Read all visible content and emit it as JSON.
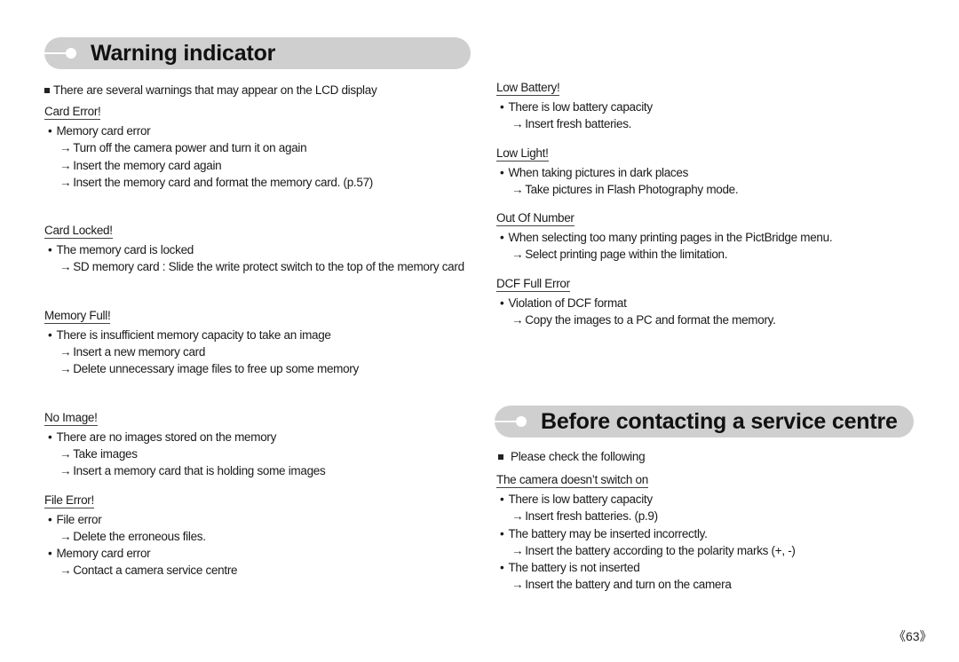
{
  "warning": {
    "title": "Warning indicator",
    "intro": "There are several warnings that may appear on the LCD display",
    "sections_left": [
      {
        "heading": "Card Error!",
        "lines": [
          {
            "type": "bullet",
            "text": "Memory card error"
          },
          {
            "type": "arrow",
            "text": "Turn off the camera power and turn it on again"
          },
          {
            "type": "arrow",
            "text": "Insert the memory card again"
          },
          {
            "type": "arrow",
            "text": "Insert the memory card and format the memory card. (p.57)"
          }
        ]
      },
      {
        "heading": "Card Locked!",
        "lines": [
          {
            "type": "bullet",
            "text": "The memory card is locked"
          },
          {
            "type": "arrow",
            "text": "SD memory card : Slide the write protect switch to the top of the memory card"
          }
        ]
      },
      {
        "heading": "Memory Full!",
        "lines": [
          {
            "type": "bullet",
            "text": "There is insufficient memory capacity to take an image"
          },
          {
            "type": "arrow",
            "text": "Insert a new memory card"
          },
          {
            "type": "arrow",
            "text": "Delete unnecessary image files to free up some memory"
          }
        ]
      },
      {
        "heading": "No Image!",
        "lines": [
          {
            "type": "bullet",
            "text": "There are no images stored on the memory"
          },
          {
            "type": "arrow",
            "text": "Take images"
          },
          {
            "type": "arrow",
            "text": "Insert a memory card that is holding some images"
          }
        ]
      },
      {
        "heading": "File Error!",
        "lines": [
          {
            "type": "bullet",
            "text": "File error"
          },
          {
            "type": "arrow",
            "text": "Delete the erroneous files."
          },
          {
            "type": "bullet",
            "text": "Memory card error"
          },
          {
            "type": "arrow",
            "text": "Contact a camera service centre"
          }
        ]
      }
    ],
    "sections_right": [
      {
        "heading": "Low Battery!",
        "lines": [
          {
            "type": "bullet",
            "text": "There is low battery capacity"
          },
          {
            "type": "arrow",
            "text": "Insert fresh batteries."
          }
        ]
      },
      {
        "heading": "Low Light!",
        "lines": [
          {
            "type": "bullet",
            "text": "When taking pictures in dark places"
          },
          {
            "type": "arrow",
            "text": "Take pictures in Flash Photography mode."
          }
        ]
      },
      {
        "heading": "Out Of Number",
        "lines": [
          {
            "type": "bullet",
            "text": "When selecting too many printing pages in the PictBridge menu."
          },
          {
            "type": "arrow",
            "text": "Select printing page within the limitation."
          }
        ]
      },
      {
        "heading": "DCF Full Error",
        "lines": [
          {
            "type": "bullet",
            "text": "Violation of DCF format"
          },
          {
            "type": "arrow",
            "text": "Copy the images to a PC and format the memory."
          }
        ]
      }
    ]
  },
  "service": {
    "title": "Before contacting a service centre",
    "intro": "Please check the following",
    "sections": [
      {
        "heading": "The camera doesn’t switch on",
        "lines": [
          {
            "type": "bullet",
            "text": "There is low battery capacity"
          },
          {
            "type": "arrow",
            "text": "Insert fresh batteries. (p.9)"
          },
          {
            "type": "bullet",
            "text": "The battery may be inserted incorrectly."
          },
          {
            "type": "arrow",
            "text": "Insert the battery according to the polarity marks (+, -)"
          },
          {
            "type": "bullet",
            "text": "The battery is not inserted"
          },
          {
            "type": "arrow",
            "text": "Insert the battery and turn on the camera"
          }
        ]
      }
    ]
  },
  "markers": {
    "bullet": "•",
    "arrow": "→"
  },
  "page_number": "《63》"
}
